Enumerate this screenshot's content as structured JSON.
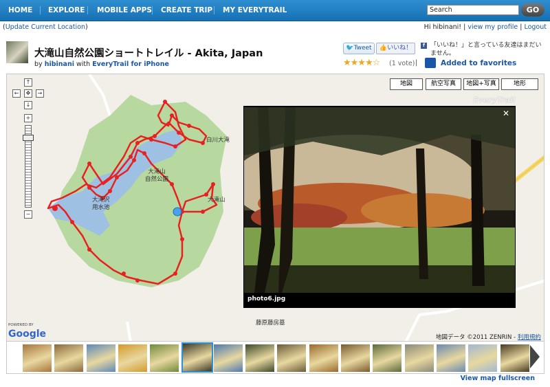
{
  "nav": {
    "items": [
      "HOME",
      "EXPLORE",
      "MOBILE APPS",
      "CREATE TRIP",
      "MY EVERYTRAIL"
    ],
    "search_value": "Search",
    "go_label": "GO"
  },
  "location_link": "Update Current Location",
  "user": {
    "greeting": "Hi hibinani!",
    "profile_link": "view my profile",
    "logout_link": "Logout",
    "sep": "|"
  },
  "trip": {
    "title": "大滝山自然公園ショートトレイル - Akita, Japan",
    "by_label": "by",
    "author": "hibinani",
    "with_label": "with",
    "app": "EveryTrail for iPhone"
  },
  "social": {
    "tweet_label": "Tweet",
    "like_label": "いいね！",
    "fb_icon": "f",
    "fb_note": "「いいね！」と言っている友達はまだいません。",
    "rating_stars": "★★★★☆",
    "votes": "(1 vote)",
    "sep": "|",
    "favorites_label": "Added to favorites"
  },
  "map": {
    "types": [
      "地図",
      "航空写真",
      "地図+写真",
      "地形"
    ],
    "controls": [
      "↑",
      "←",
      "✥",
      "→",
      "↓",
      "+",
      "−"
    ],
    "labels": {
      "reservoir": "大滝沢\n用水池",
      "park": "大滝山\n自然公園",
      "mountain": "大滝山",
      "falls": "白川大滝",
      "tomb": "藤原藤房墓"
    },
    "watermark": "EveryTrail",
    "powered_by": "POWERED BY",
    "google": "Google",
    "copyright": "地図データ ©2011 ZENRIN - ",
    "terms_link": "利用規約",
    "route_color": "#e8201f",
    "park_color": "#b7d9a0",
    "water_color": "#9ec0e3"
  },
  "photo": {
    "caption": "photo6.jpg",
    "close_glyph": "✕"
  },
  "filmstrip": {
    "selected_index": 5,
    "thumb_colors": [
      "#a8753c",
      "#8b6a3a",
      "#5d89b8",
      "#d49a2a",
      "#6f8a3a",
      "#3e3a28",
      "#4f7ab0",
      "#3d4a2a",
      "#6b5a3a",
      "#9a6a2a",
      "#7a5a2e",
      "#5c6a3c",
      "#8a8a7a",
      "#6a8ab0",
      "#a0b8d0",
      "#4a3a22"
    ]
  },
  "fullscreen_link": "View map fullscreen"
}
